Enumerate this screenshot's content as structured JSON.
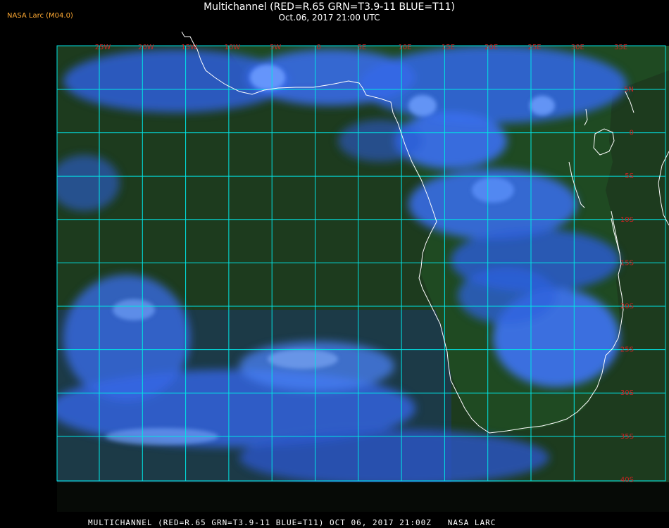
{
  "header": {
    "title": "Multichannel (RED=R.65 GRN=T3.9-11 BLUE=T11)",
    "subtitle": "Oct.06, 2017 21:00 UTC",
    "credit": "NASA Larc (M04.0)"
  },
  "footer": {
    "caption": "MULTICHANNEL (RED=R.65 GRN=T3.9-11 BLUE=T11) OCT 06, 2017 21:00Z   NASA LARC"
  },
  "map": {
    "longitude_labels": [
      "25W",
      "20W",
      "15W",
      "10W",
      "5W",
      "0",
      "5E",
      "10E",
      "15E",
      "20E",
      "25E",
      "30E",
      "35E"
    ],
    "latitude_labels": [
      "5N",
      "0",
      "5S",
      "10S",
      "15S",
      "20S",
      "25S",
      "30S",
      "35S",
      "40S"
    ],
    "colors": {
      "ocean": "#1e3a1f",
      "cloud": "#3a6cf0",
      "grid": "#00e5e5",
      "coastline": "#ffffff",
      "label": "#cc2222"
    }
  }
}
